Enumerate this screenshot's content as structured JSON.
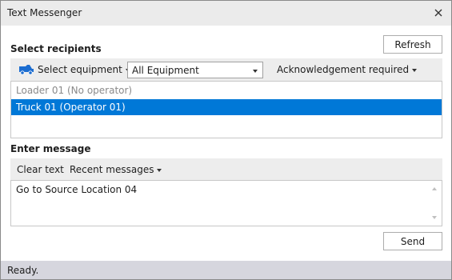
{
  "window": {
    "title": "Text Messenger"
  },
  "recipients": {
    "heading": "Select recipients",
    "refresh_label": "Refresh",
    "toolbar": {
      "select_equipment_label": "Select equipment",
      "equipment_filter_value": "All Equipment",
      "acknowledgement_label": "Acknowledgement required"
    },
    "items": [
      {
        "label": "Loader 01 (No operator)",
        "state": "disabled"
      },
      {
        "label": "Truck 01 (Operator 01)",
        "state": "selected"
      }
    ]
  },
  "message": {
    "heading": "Enter message",
    "clear_label": "Clear text",
    "recent_label": "Recent messages",
    "text": "Go to Source Location 04",
    "send_label": "Send"
  },
  "status": {
    "text": "Ready."
  },
  "colors": {
    "selection": "#0078d7",
    "titlebar": "#ebebeb",
    "toolbar": "#ededed",
    "statusbar": "#d6d6de",
    "truck_icon": "#1c6dd0"
  },
  "icons": {
    "equipment": "truck-icon",
    "close": "close-icon"
  }
}
